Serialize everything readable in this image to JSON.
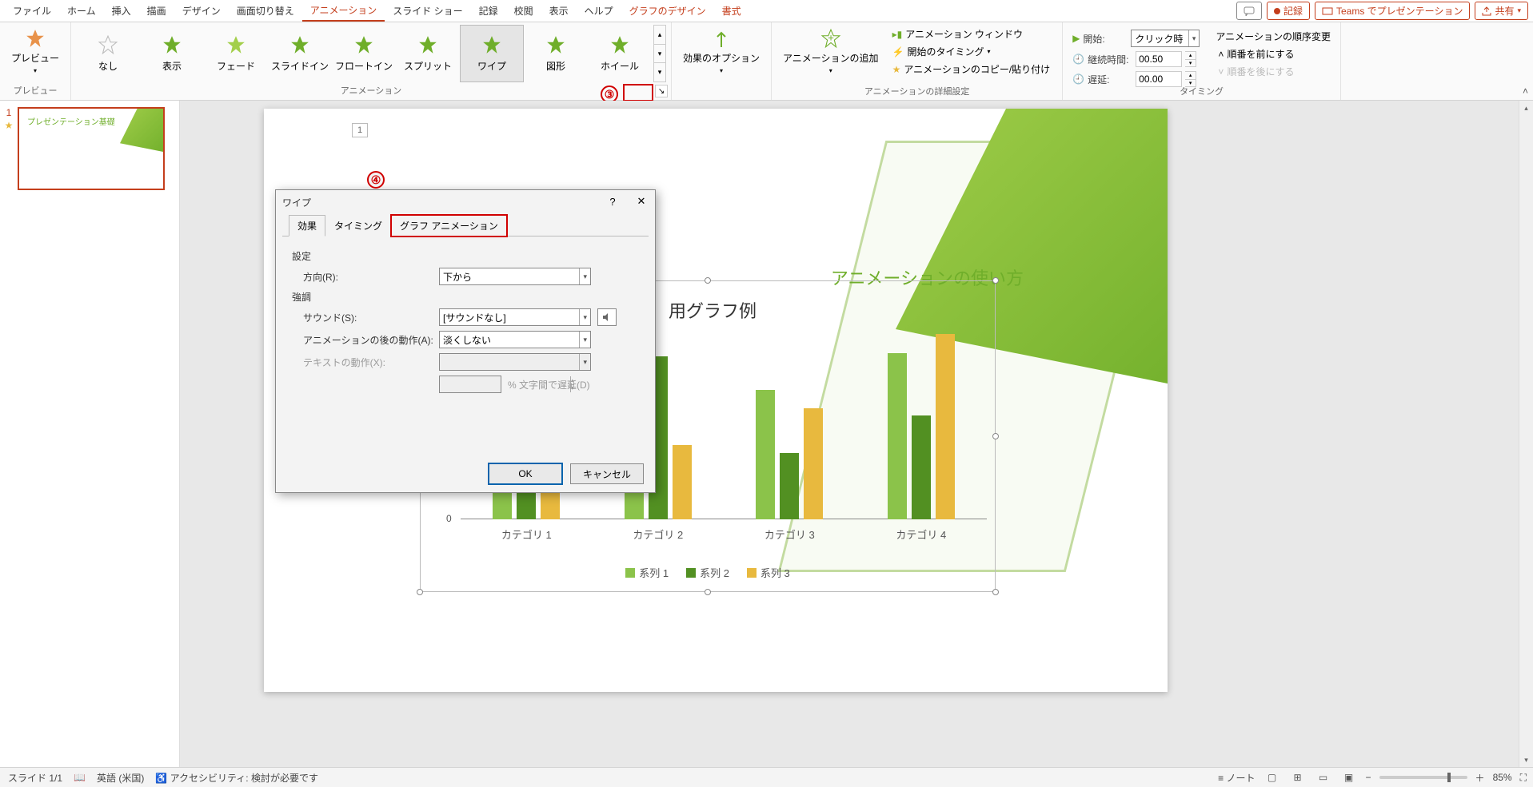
{
  "tabs": [
    "ファイル",
    "ホーム",
    "挿入",
    "描画",
    "デザイン",
    "画面切り替え",
    "アニメーション",
    "スライド ショー",
    "記録",
    "校閲",
    "表示",
    "ヘルプ",
    "グラフのデザイン",
    "書式"
  ],
  "active_tab": "アニメーション",
  "rhs": {
    "comments": "",
    "record": "記録",
    "teams": "Teams でプレゼンテーション",
    "share": "共有"
  },
  "groups": {
    "preview": {
      "label": "プレビュー",
      "btn": "プレビュー"
    },
    "anim": {
      "label": "アニメーション",
      "items": [
        "なし",
        "表示",
        "フェード",
        "スライドイン",
        "フロートイン",
        "スプリット",
        "ワイプ",
        "図形",
        "ホイール"
      ],
      "selected": "ワイプ"
    },
    "options": {
      "label": "効果のオプション"
    },
    "addanim": {
      "label": "アニメーションの追加"
    },
    "adv": {
      "label": "アニメーションの詳細設定",
      "pane": "アニメーション ウィンドウ",
      "trigger": "開始のタイミング",
      "painter": "アニメーションのコピー/貼り付け"
    },
    "timing": {
      "label": "タイミング",
      "start_lbl": "開始:",
      "start_val": "クリック時",
      "dur_lbl": "継続時間:",
      "dur_val": "00.50",
      "delay_lbl": "遅延:",
      "delay_val": "00.00",
      "reorder_lbl": "アニメーションの順序変更",
      "earlier": "順番を前にする",
      "later": "順番を後にする"
    }
  },
  "badges": {
    "three": "③",
    "four": "④"
  },
  "thumb": {
    "num": "1",
    "star": "★"
  },
  "slide": {
    "num": "1",
    "title": "ション基礎",
    "title_prefix": "プ",
    "subtitle": "アニメーションの使い方",
    "chart_title": "用グラフ例",
    "mini_title": "プレゼンテーション基礎"
  },
  "chart_data": {
    "type": "bar",
    "categories": [
      "カテゴリ 1",
      "カテゴリ 2",
      "カテゴリ 3",
      "カテゴリ 4"
    ],
    "series": [
      {
        "name": "系列 1",
        "values": [
          4.3,
          2.5,
          3.5,
          4.5
        ]
      },
      {
        "name": "系列 2",
        "values": [
          2.4,
          4.4,
          1.8,
          2.8
        ]
      },
      {
        "name": "系列 3",
        "values": [
          2.0,
          2.0,
          3.0,
          5.0
        ]
      }
    ],
    "ylim": [
      0,
      6
    ],
    "tick0": "0",
    "colors": [
      "#8bc34a",
      "#529022",
      "#e8b93e"
    ]
  },
  "dialog": {
    "title": "ワイプ",
    "help": "?",
    "close": "✕",
    "tabs": [
      "効果",
      "タイミング",
      "グラフ アニメーション"
    ],
    "active": "効果",
    "highlight": "グラフ アニメーション",
    "sec_settings": "設定",
    "direction_lbl": "方向(R):",
    "direction_val": "下から",
    "sec_enhance": "強調",
    "sound_lbl": "サウンド(S):",
    "sound_val": "[サウンドなし]",
    "after_lbl": "アニメーションの後の動作(A):",
    "after_val": "淡くしない",
    "text_lbl": "テキストの動作(X):",
    "text_val": "",
    "pct_post": "% 文字間で遅延(D)",
    "ok": "OK",
    "cancel": "キャンセル"
  },
  "status": {
    "slide": "スライド 1/1",
    "lang": "英語 (米国)",
    "a11y": "アクセシビリティ: 検討が必要です",
    "notes": "ノート",
    "zoom": "85%",
    "minus": "−",
    "plus": "＋",
    "fit": "⛶"
  }
}
